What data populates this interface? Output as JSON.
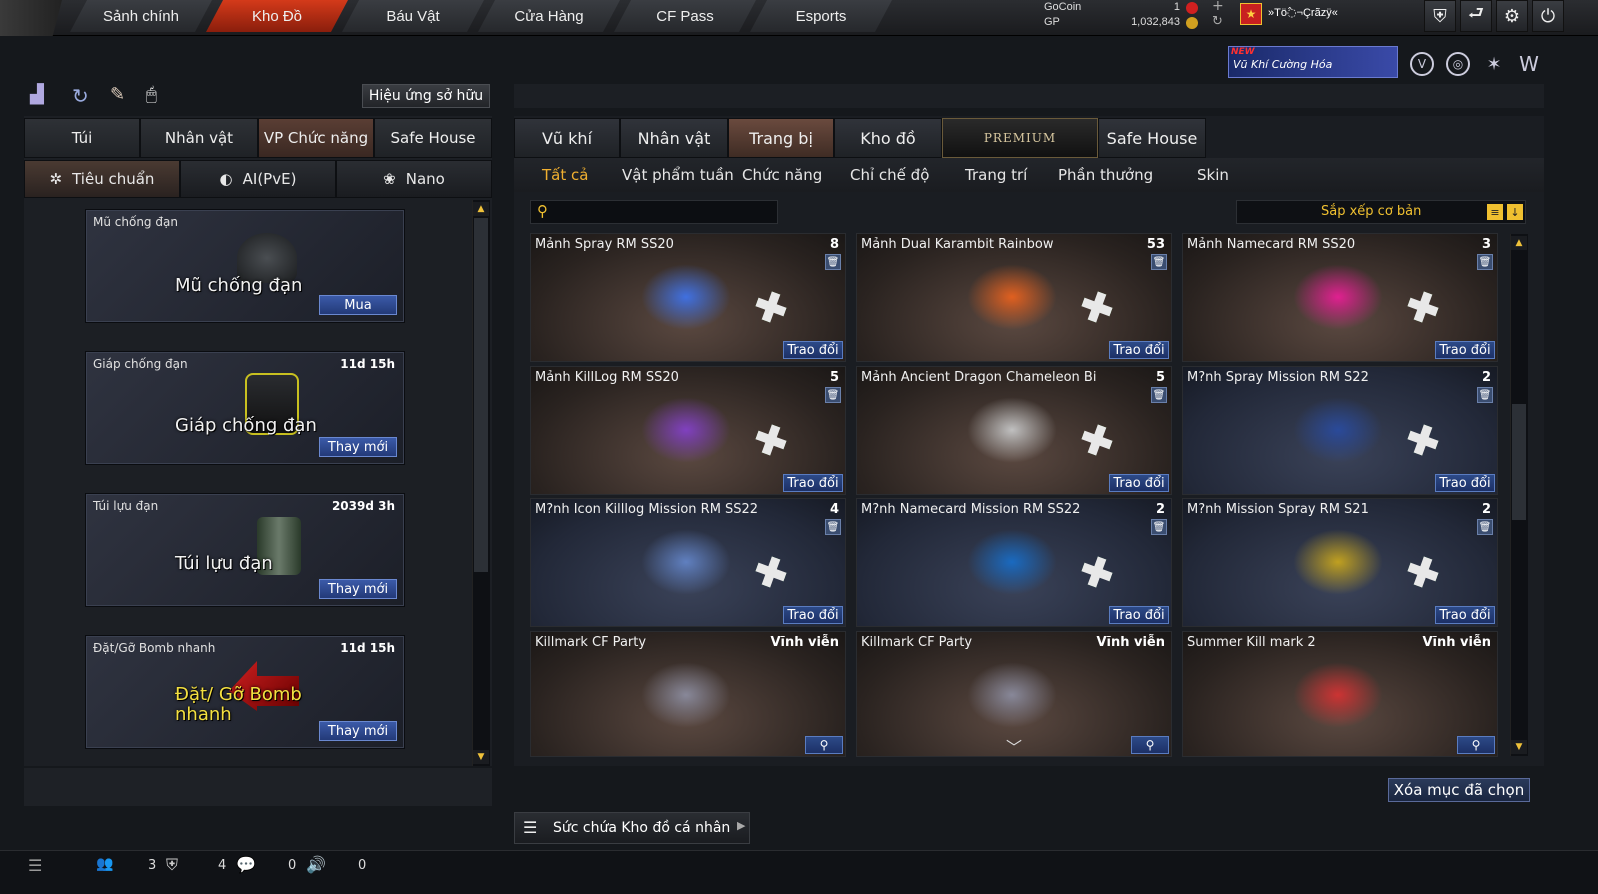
{
  "topnav": {
    "tabs": [
      "Sảnh chính",
      "Kho Đồ",
      "Báu Vật",
      "Cửa Hàng",
      "CF Pass",
      "Esports"
    ],
    "active": "Kho Đồ"
  },
  "currency": {
    "gocoin_label": "GoCoin",
    "gocoin_value": "1",
    "gp_label": "GP",
    "gp_value": "1,032,843"
  },
  "player": {
    "name": "»Tö߮¬Çrãzÿ«"
  },
  "banner": {
    "new": "NEW",
    "text": "Vũ Khí Cường Hóa"
  },
  "left": {
    "effect_button": "Hiệu ứng sở hữu",
    "tabs": [
      "Túi",
      "Nhân vật",
      "VP Chức năng",
      "Safe House"
    ],
    "active_tab": "VP Chức năng",
    "subtabs": [
      "Tiêu chuẩn",
      "AI(PvE)",
      "Nano"
    ],
    "cards": [
      {
        "title": "Mũ chống đạn",
        "time": "",
        "big": "Mũ chống đạn",
        "button": "Mua"
      },
      {
        "title": "Giáp chống đạn",
        "time": "11d 15h",
        "big": "Giáp chống đạn",
        "button": "Thay mới"
      },
      {
        "title": "Túi lựu đạn",
        "time": "2039d 3h",
        "big": "Túi lựu đạn",
        "button": "Thay mới"
      },
      {
        "title": "Đặt/Gỡ Bomb nhanh",
        "time": "11d 15h",
        "big": "Đặt/ Gỡ Bomb nhanh",
        "button": "Thay mới"
      }
    ]
  },
  "right": {
    "tabs": [
      "Vũ khí",
      "Nhân vật",
      "Trang bị",
      "Kho đồ",
      "PREMIUM",
      "Safe House"
    ],
    "active_tab": "Trang bị",
    "filters": [
      "Tất cả",
      "Vật phẩm tuần",
      "Chức năng",
      "Chỉ chế độ",
      "Trang trí",
      "Phần thưởng",
      "Skin"
    ],
    "active_filter": "Tất cả",
    "search_placeholder": "",
    "sort_label": "Sắp xếp cơ bản",
    "items": [
      {
        "name": "Mảnh Spray RM SS20",
        "qty": "8",
        "button": "Trao đổi"
      },
      {
        "name": "Mảnh Dual Karambit Rainbow",
        "qty": "53",
        "button": "Trao đổi"
      },
      {
        "name": "Mảnh Namecard RM SS20",
        "qty": "3",
        "button": "Trao đổi"
      },
      {
        "name": "Mảnh KillLog RM SS20",
        "qty": "5",
        "button": "Trao đổi"
      },
      {
        "name": "Mảnh Ancient Dragon Chameleon Bi",
        "qty": "5",
        "button": "Trao đổi"
      },
      {
        "name": "M?nh Spray Mission RM S22",
        "qty": "2",
        "button": "Trao đổi"
      },
      {
        "name": "M?nh Icon Killlog Mission RM SS22",
        "qty": "4",
        "button": "Trao đổi"
      },
      {
        "name": "M?nh Namecard Mission RM SS22",
        "qty": "2",
        "button": "Trao đổi"
      },
      {
        "name": "M?nh Mission Spray RM S21",
        "qty": "2",
        "button": "Trao đổi"
      },
      {
        "name": "Killmark CF Party",
        "qty": "Vĩnh viễn",
        "button": ""
      },
      {
        "name": "Killmark CF Party",
        "qty": "Vĩnh viễn",
        "button": ""
      },
      {
        "name": "Summer Kill mark 2",
        "qty": "Vĩnh viễn",
        "button": ""
      }
    ],
    "delete_button": "Xóa mục đã chọn",
    "capacity_label": "Sức chứa Kho đồ cá nhân"
  },
  "bottom": {
    "counts": [
      "3",
      "4",
      "0",
      "0"
    ]
  }
}
